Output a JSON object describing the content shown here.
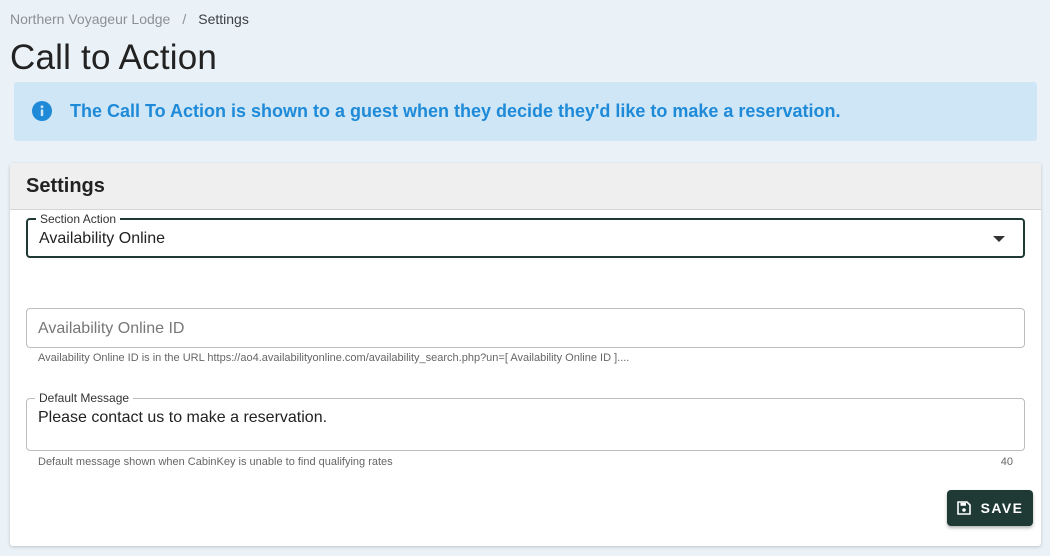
{
  "breadcrumb": {
    "parent": "Northern Voyageur Lodge",
    "separator": "/",
    "current": "Settings"
  },
  "page_title": "Call to Action",
  "alert": {
    "icon": "info-icon",
    "text": "The Call To Action is shown to a guest when they decide they'd like to make a reservation.",
    "color": "#1e8ad8",
    "background": "#cfe6f6"
  },
  "settings_card": {
    "title": "Settings",
    "section_action": {
      "label": "Section Action",
      "value": "Availability Online"
    },
    "availability_online_id": {
      "placeholder": "Availability Online ID",
      "value": "",
      "helper": "Availability Online ID is in the URL https://ao4.availabilityonline.com/availability_search.php?un=[ Availability Online ID ]...."
    },
    "default_message": {
      "label": "Default Message",
      "value": "Please contact us to make a reservation.",
      "helper": "Default message shown when CabinKey is unable to find qualifying rates",
      "counter": "40"
    },
    "save_button": {
      "label": "SAVE",
      "icon": "floppy-disk-icon",
      "color": "#1f3a35"
    }
  }
}
